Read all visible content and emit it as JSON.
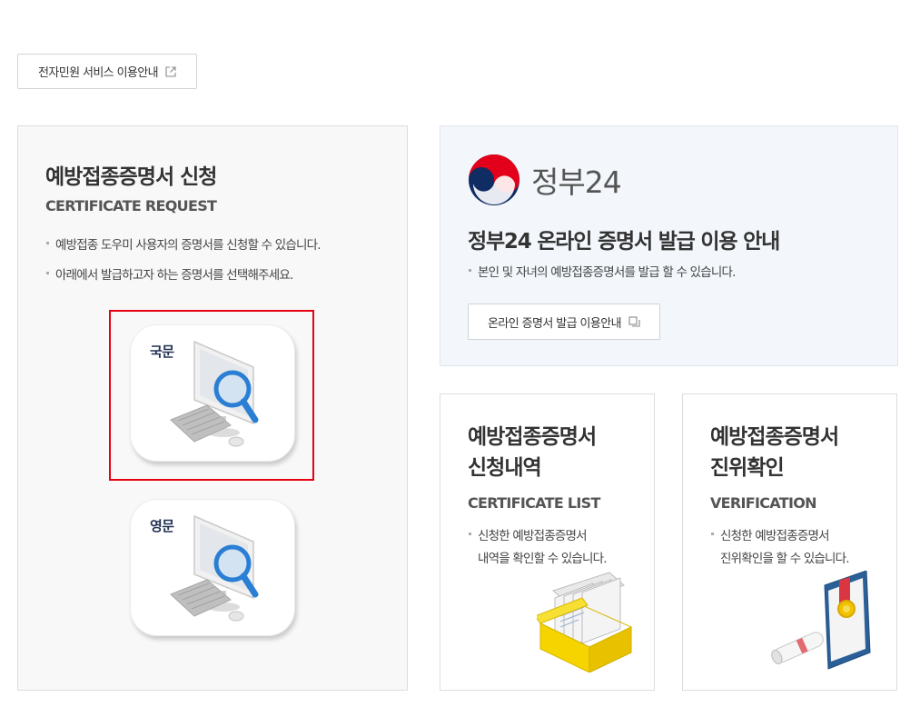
{
  "guide_button": {
    "label": "전자민원 서비스 이용안내",
    "icon": "external-link-icon"
  },
  "request_panel": {
    "title": "예방접종증명서 신청",
    "subtitle": "CERTIFICATE REQUEST",
    "bullets": [
      "예방접종 도우미 사용자의 증명서를 신청할 수 있습니다.",
      "아래에서 발급하고자 하는 증명서를 선택해주세요."
    ],
    "options": [
      {
        "label": "국문",
        "icon": "computer-search-icon"
      },
      {
        "label": "영문",
        "icon": "computer-search-icon"
      }
    ]
  },
  "gov24_panel": {
    "logo_text": "정부24",
    "title": "정부24 온라인 증명서 발급 이용 안내",
    "bullet": "본인 및 자녀의 예방접종증명서를 발급 할 수 있습니다.",
    "button_label": "온라인 증명서 발급 이용안내",
    "button_icon": "copy-icon"
  },
  "list_panel": {
    "title_line1": "예방접종증명서",
    "title_line2": "신청내역",
    "subtitle": "CERTIFICATE LIST",
    "bullet_line1": "신청한 예방접종증명서",
    "bullet_line2": "내역을 확인할 수 있습니다.",
    "icon": "document-box-icon"
  },
  "verify_panel": {
    "title_line1": "예방접종증명서",
    "title_line2": "진위확인",
    "subtitle": "VERIFICATION",
    "bullet_line1": "신청한 예방접종증명서",
    "bullet_line2": "진위확인을 할 수 있습니다.",
    "icon": "certificate-award-icon"
  },
  "colors": {
    "highlight": "#e60012",
    "gov_bg": "#f3f7fb",
    "magnifier": "#2a7fd4",
    "box_yellow": "#f5d400"
  }
}
